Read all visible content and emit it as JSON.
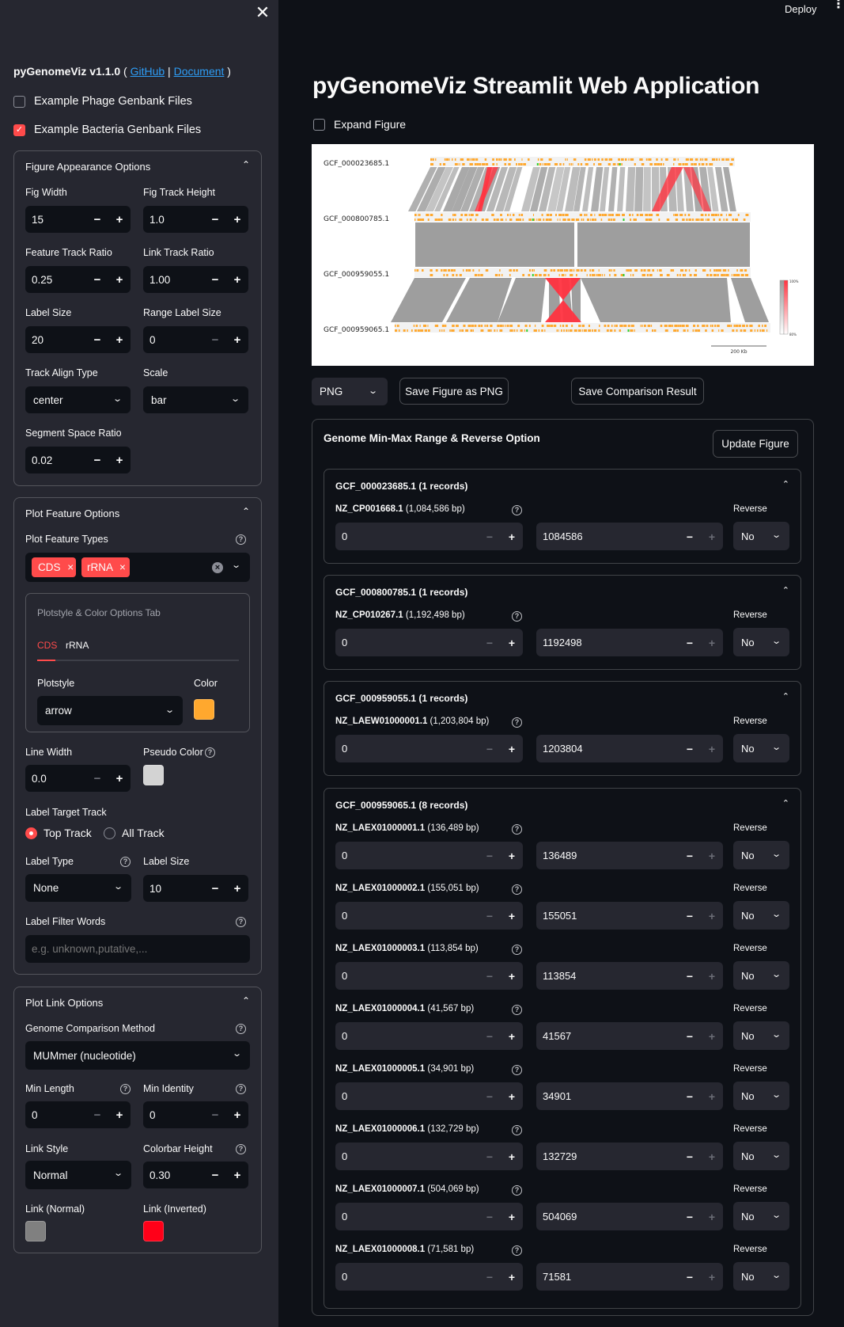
{
  "header": {
    "deploy_label": "Deploy",
    "menu_icon": "⋮"
  },
  "sidebar": {
    "close_icon": "✕",
    "app_name": "pyGenomeViz v1.1.0",
    "open_paren": " ( ",
    "github_link": "GitHub",
    "separator": " | ",
    "document_link": "Document",
    "close_paren": " )",
    "example_phage": {
      "label": "Example Phage Genbank Files",
      "checked": false
    },
    "example_bacteria": {
      "label": "Example Bacteria Genbank Files",
      "checked": true
    },
    "figure_appearance": {
      "title": "Figure Appearance Options",
      "fig_width": {
        "label": "Fig Width",
        "value": "15"
      },
      "fig_track_height": {
        "label": "Fig Track Height",
        "value": "1.0"
      },
      "feature_track_ratio": {
        "label": "Feature Track Ratio",
        "value": "0.25"
      },
      "link_track_ratio": {
        "label": "Link Track Ratio",
        "value": "1.00"
      },
      "label_size": {
        "label": "Label Size",
        "value": "20"
      },
      "range_label_size": {
        "label": "Range Label Size",
        "value": "0"
      },
      "track_align_type": {
        "label": "Track Align Type",
        "value": "center"
      },
      "scale": {
        "label": "Scale",
        "value": "bar"
      },
      "segment_space_ratio": {
        "label": "Segment Space Ratio",
        "value": "0.02"
      }
    },
    "plot_feature": {
      "title": "Plot Feature Options",
      "feature_types_label": "Plot Feature Types",
      "feature_types": [
        "CDS",
        "rRNA"
      ],
      "tab_box_title": "Plotstyle & Color Options Tab",
      "tabs": [
        "CDS",
        "rRNA"
      ],
      "active_tab": "CDS",
      "plotstyle_label": "Plotstyle",
      "plotstyle_value": "arrow",
      "color_label": "Color",
      "color_value": "#ffa82e",
      "line_width": {
        "label": "Line Width",
        "value": "0.0"
      },
      "pseudo_color_label": "Pseudo Color",
      "pseudo_color_value": "#d3d3d3",
      "label_target_track_label": "Label Target Track",
      "label_target_options": [
        "Top Track",
        "All Track"
      ],
      "label_target_selected": "Top Track",
      "label_type": {
        "label": "Label Type",
        "value": "None"
      },
      "label_size": {
        "label": "Label Size",
        "value": "10"
      },
      "label_filter_words": {
        "label": "Label Filter Words",
        "placeholder": "e.g. unknown,putative,..."
      }
    },
    "plot_link": {
      "title": "Plot Link Options",
      "method": {
        "label": "Genome Comparison Method",
        "value": "MUMmer (nucleotide)"
      },
      "min_length": {
        "label": "Min Length",
        "value": "0"
      },
      "min_identity": {
        "label": "Min Identity",
        "value": "0"
      },
      "link_style": {
        "label": "Link Style",
        "value": "Normal"
      },
      "colorbar_height": {
        "label": "Colorbar Height",
        "value": "0.30"
      },
      "link_normal": {
        "label": "Link (Normal)",
        "color": "#808080"
      },
      "link_inverted": {
        "label": "Link (Inverted)",
        "color": "#ff0018"
      }
    }
  },
  "main": {
    "title": "pyGenomeViz Streamlit Web Application",
    "expand_figure": {
      "label": "Expand Figure",
      "checked": false
    },
    "figure": {
      "genomes": [
        "GCF_000023685.1",
        "GCF_000800785.1",
        "GCF_000959055.1",
        "GCF_000959065.1"
      ],
      "colorbar_max_label": "100%",
      "colorbar_min_label": "80%",
      "scale_bar_label": "200 Kb",
      "feature_color": "#ffa82e",
      "rrna_color": "#2ed12e",
      "link_normal_color": "#999999",
      "link_inverted_color": "#ff3340"
    },
    "format_select": "PNG",
    "save_figure_button": "Save Figure as PNG",
    "save_comparison_button": "Save Comparison Result",
    "range_box": {
      "title": "Genome Min-Max Range & Reverse Option",
      "update_button": "Update Figure",
      "reverse_label": "Reverse",
      "genomes": [
        {
          "header": "GCF_000023685.1 (1 records)",
          "records": [
            {
              "id": "NZ_CP001668.1",
              "size": "(1,084,586 bp)",
              "min": "0",
              "max": "1084586",
              "reverse": "No"
            }
          ]
        },
        {
          "header": "GCF_000800785.1 (1 records)",
          "records": [
            {
              "id": "NZ_CP010267.1",
              "size": "(1,192,498 bp)",
              "min": "0",
              "max": "1192498",
              "reverse": "No"
            }
          ]
        },
        {
          "header": "GCF_000959055.1 (1 records)",
          "records": [
            {
              "id": "NZ_LAEW01000001.1",
              "size": "(1,203,804 bp)",
              "min": "0",
              "max": "1203804",
              "reverse": "No"
            }
          ]
        },
        {
          "header": "GCF_000959065.1 (8 records)",
          "records": [
            {
              "id": "NZ_LAEX01000001.1",
              "size": "(136,489 bp)",
              "min": "0",
              "max": "136489",
              "reverse": "No"
            },
            {
              "id": "NZ_LAEX01000002.1",
              "size": "(155,051 bp)",
              "min": "0",
              "max": "155051",
              "reverse": "No"
            },
            {
              "id": "NZ_LAEX01000003.1",
              "size": "(113,854 bp)",
              "min": "0",
              "max": "113854",
              "reverse": "No"
            },
            {
              "id": "NZ_LAEX01000004.1",
              "size": "(41,567 bp)",
              "min": "0",
              "max": "41567",
              "reverse": "No"
            },
            {
              "id": "NZ_LAEX01000005.1",
              "size": "(34,901 bp)",
              "min": "0",
              "max": "34901",
              "reverse": "No"
            },
            {
              "id": "NZ_LAEX01000006.1",
              "size": "(132,729 bp)",
              "min": "0",
              "max": "132729",
              "reverse": "No"
            },
            {
              "id": "NZ_LAEX01000007.1",
              "size": "(504,069 bp)",
              "min": "0",
              "max": "504069",
              "reverse": "No"
            },
            {
              "id": "NZ_LAEX01000008.1",
              "size": "(71,581 bp)",
              "min": "0",
              "max": "71581",
              "reverse": "No"
            }
          ]
        }
      ]
    }
  },
  "icons": {
    "chevron_up": "⌃",
    "chevron_down": "⌄",
    "minus": "−",
    "plus": "+",
    "help": "?",
    "tag_remove": "×",
    "clear_all": "×",
    "check": "✓"
  }
}
